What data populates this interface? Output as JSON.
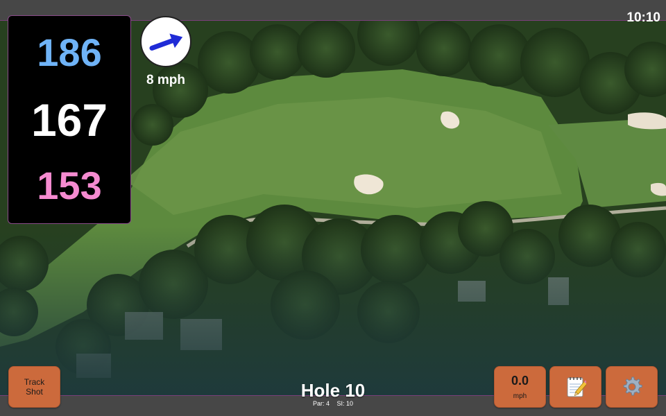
{
  "status_bar": {
    "clock": "10:10"
  },
  "distances": {
    "back": "186",
    "middle": "167",
    "front": "153",
    "back_color": "#6fb3f7",
    "middle_color": "#ffffff",
    "front_color": "#f58bd0"
  },
  "wind": {
    "speed_label": "8 mph",
    "icon": "wind-direction-arrow-icon",
    "arrow_color": "#1f2bd6"
  },
  "track_shot": {
    "label_line1": "Track",
    "label_line2": "Shot"
  },
  "speed_display": {
    "value": "0.0",
    "unit": "mph"
  },
  "notes": {
    "icon": "notepad-icon"
  },
  "settings": {
    "icon": "gear-icon"
  },
  "hole": {
    "title": "Hole 10",
    "par": "Par: 4",
    "stroke_index": "SI: 10"
  },
  "colors": {
    "accent": "#cc6a3c",
    "bar": "#474747",
    "border": "#8a4b8a"
  }
}
